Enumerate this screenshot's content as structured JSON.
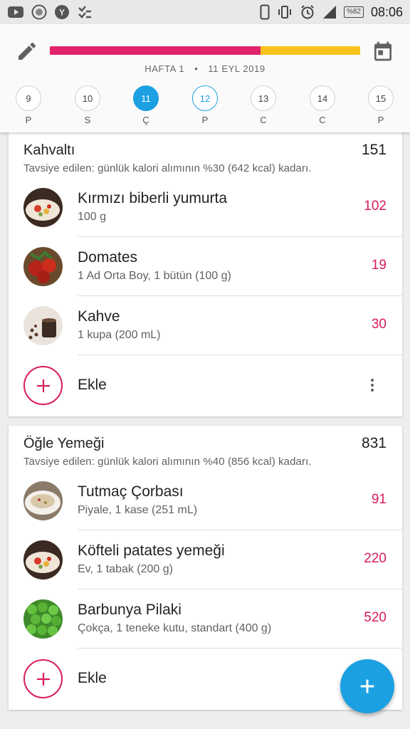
{
  "status_bar": {
    "battery": "%82",
    "time": "08:06"
  },
  "header": {
    "progress_fraction": 0.68,
    "week_label": "HAFTA 1",
    "separator": "•",
    "date_label": "11 EYL 2019",
    "colors": {
      "progress_red": "#e2226b",
      "progress_yellow": "#f7c21b",
      "accent_blue": "#1ba0e2"
    },
    "days": [
      {
        "num": "9",
        "letter": "P",
        "state": "normal"
      },
      {
        "num": "10",
        "letter": "S",
        "state": "normal"
      },
      {
        "num": "11",
        "letter": "Ç",
        "state": "selected"
      },
      {
        "num": "12",
        "letter": "P",
        "state": "today"
      },
      {
        "num": "13",
        "letter": "C",
        "state": "normal"
      },
      {
        "num": "14",
        "letter": "C",
        "state": "normal"
      },
      {
        "num": "15",
        "letter": "P",
        "state": "normal"
      }
    ]
  },
  "meals": [
    {
      "title": "Kahvaltı",
      "total": "151",
      "hint": "Tavsiye edilen: günlük kalori alımının %30 (642 kcal) kadarı.",
      "items": [
        {
          "name": "Kırmızı biberli yumurta",
          "sub": "100 g",
          "kcal": "102",
          "icon": "egg-dish-photo"
        },
        {
          "name": "Domates",
          "sub": "1 Ad Orta Boy, 1 bütün (100 g)",
          "kcal": "19",
          "icon": "tomatoes-photo"
        },
        {
          "name": "Kahve",
          "sub": "1 kupa (200 mL)",
          "kcal": "30",
          "icon": "coffee-photo"
        }
      ],
      "add_label": "Ekle"
    },
    {
      "title": "Öğle Yemeği",
      "total": "831",
      "hint": "Tavsiye edilen: günlük kalori alımının %40 (856 kcal) kadarı.",
      "items": [
        {
          "name": "Tutmaç Çorbası",
          "sub": "Piyale, 1 kase (251 mL)",
          "kcal": "91",
          "icon": "soup-photo"
        },
        {
          "name": "Köfteli patates yemeği",
          "sub": "Ev, 1 tabak (200 g)",
          "kcal": "220",
          "icon": "meatball-dish-photo"
        },
        {
          "name": "Barbunya Pilaki",
          "sub": "Çokça, 1 teneke kutu, standart (400 g)",
          "kcal": "520",
          "icon": "peas-photo"
        }
      ],
      "add_label": "Ekle"
    }
  ]
}
